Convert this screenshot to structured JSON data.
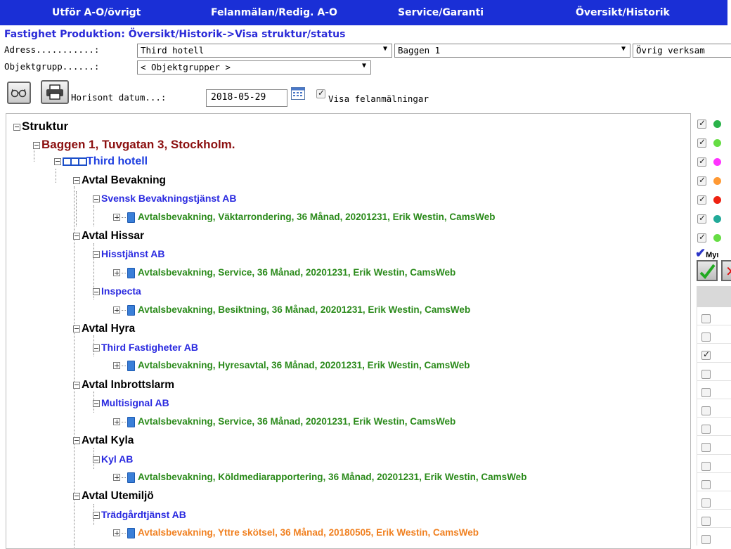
{
  "nav": {
    "items": [
      {
        "label": "Utför A-O/övrigt"
      },
      {
        "label": "Felanmälan/Redig. A-O"
      },
      {
        "label": "Service/Garanti"
      },
      {
        "label": "Översikt/Historik"
      }
    ]
  },
  "breadcrumb": "Fastighet Produktion: Översikt/Historik->Visa struktur/status",
  "form": {
    "adress_label": "Adress...........:",
    "adress_value": "Third hotell",
    "fastighet_value": "Baggen 1",
    "verksamhet_value": "Övrig verksam",
    "objektgrupp_label": "Objektgrupp......:",
    "objektgrupp_value": "< Objektgrupper >",
    "horisont_label": "Horisont datum...:",
    "horisont_value": "2018-05-29",
    "visa_label": "Visa felanmälningar",
    "visa_checked": true
  },
  "tree": {
    "root": "Struktur",
    "property": "Baggen 1, Tuvgatan 3, Stockholm.",
    "building": "Third hotell",
    "contracts": [
      {
        "label": "Avtal Bevakning",
        "suppliers": [
          {
            "label": "Svensk Bevakningstjänst AB",
            "items": [
              {
                "label": "Avtalsbevakning, Väktarrondering, 36 Månad, 20201231, Erik Westin, CamsWeb",
                "color": "#2a8a1a"
              }
            ]
          }
        ]
      },
      {
        "label": "Avtal Hissar",
        "suppliers": [
          {
            "label": "Hisstjänst AB",
            "items": [
              {
                "label": "Avtalsbevakning, Service, 36 Månad, 20201231, Erik Westin, CamsWeb",
                "color": "#2a8a1a"
              }
            ]
          },
          {
            "label": "Inspecta",
            "items": [
              {
                "label": "Avtalsbevakning, Besiktning, 36 Månad, 20201231, Erik Westin, CamsWeb",
                "color": "#2a8a1a"
              }
            ]
          }
        ]
      },
      {
        "label": "Avtal Hyra",
        "suppliers": [
          {
            "label": "Third Fastigheter AB",
            "items": [
              {
                "label": "Avtalsbevakning, Hyresavtal, 36 Månad, 20201231, Erik Westin, CamsWeb",
                "color": "#2a8a1a"
              }
            ]
          }
        ]
      },
      {
        "label": "Avtal Inbrottslarm",
        "suppliers": [
          {
            "label": "Multisignal AB",
            "items": [
              {
                "label": "Avtalsbevakning, Service, 36 Månad, 20201231, Erik Westin, CamsWeb",
                "color": "#2a8a1a"
              }
            ]
          }
        ]
      },
      {
        "label": "Avtal Kyla",
        "suppliers": [
          {
            "label": "Kyl AB",
            "items": [
              {
                "label": "Avtalsbevakning, Köldmediarapportering, 36 Månad, 20201231, Erik Westin, CamsWeb",
                "color": "#2a8a1a"
              }
            ]
          }
        ]
      },
      {
        "label": "Avtal Utemiljö",
        "suppliers": [
          {
            "label": "Trädgårdtjänst AB",
            "items": [
              {
                "label": "Avtalsbevakning, Yttre skötsel, 36 Månad, 20180505, Erik Westin, CamsWeb",
                "color": "#f08020"
              }
            ]
          }
        ]
      }
    ]
  },
  "right_panel": {
    "legend": [
      {
        "checked": true,
        "color": "#2ab34a"
      },
      {
        "checked": true,
        "color": "#66dd44"
      },
      {
        "checked": true,
        "color": "#ff33ff"
      },
      {
        "checked": true,
        "color": "#ff9933"
      },
      {
        "checked": true,
        "color": "#ee2211"
      },
      {
        "checked": true,
        "color": "#22aa99"
      },
      {
        "checked": true,
        "color": "#66dd44"
      }
    ],
    "mine_label": "Myı",
    "rows_checked": [
      false,
      false,
      true,
      false,
      false,
      false,
      false,
      false,
      false,
      false,
      false,
      false,
      false
    ]
  }
}
